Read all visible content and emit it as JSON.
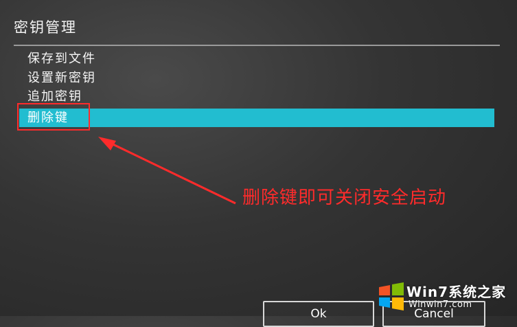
{
  "dialog": {
    "title": "密钥管理",
    "menu_items": [
      {
        "label": "保存到文件",
        "selected": false
      },
      {
        "label": "设置新密钥",
        "selected": false
      },
      {
        "label": "追加密钥",
        "selected": false
      },
      {
        "label": "删除键",
        "selected": true
      }
    ],
    "buttons": {
      "ok_label": "Ok",
      "cancel_label": "Cancel"
    }
  },
  "annotation": {
    "text": "删除键即可关闭安全启动",
    "color": "#ff2b2b"
  },
  "watermark": {
    "brand": "Win7系统之家",
    "url": "Winwin7.com"
  },
  "colors": {
    "background": "#343434",
    "selection": "#22bdd0",
    "annotation": "#ff2b2b",
    "text": "#f6f6f6"
  }
}
